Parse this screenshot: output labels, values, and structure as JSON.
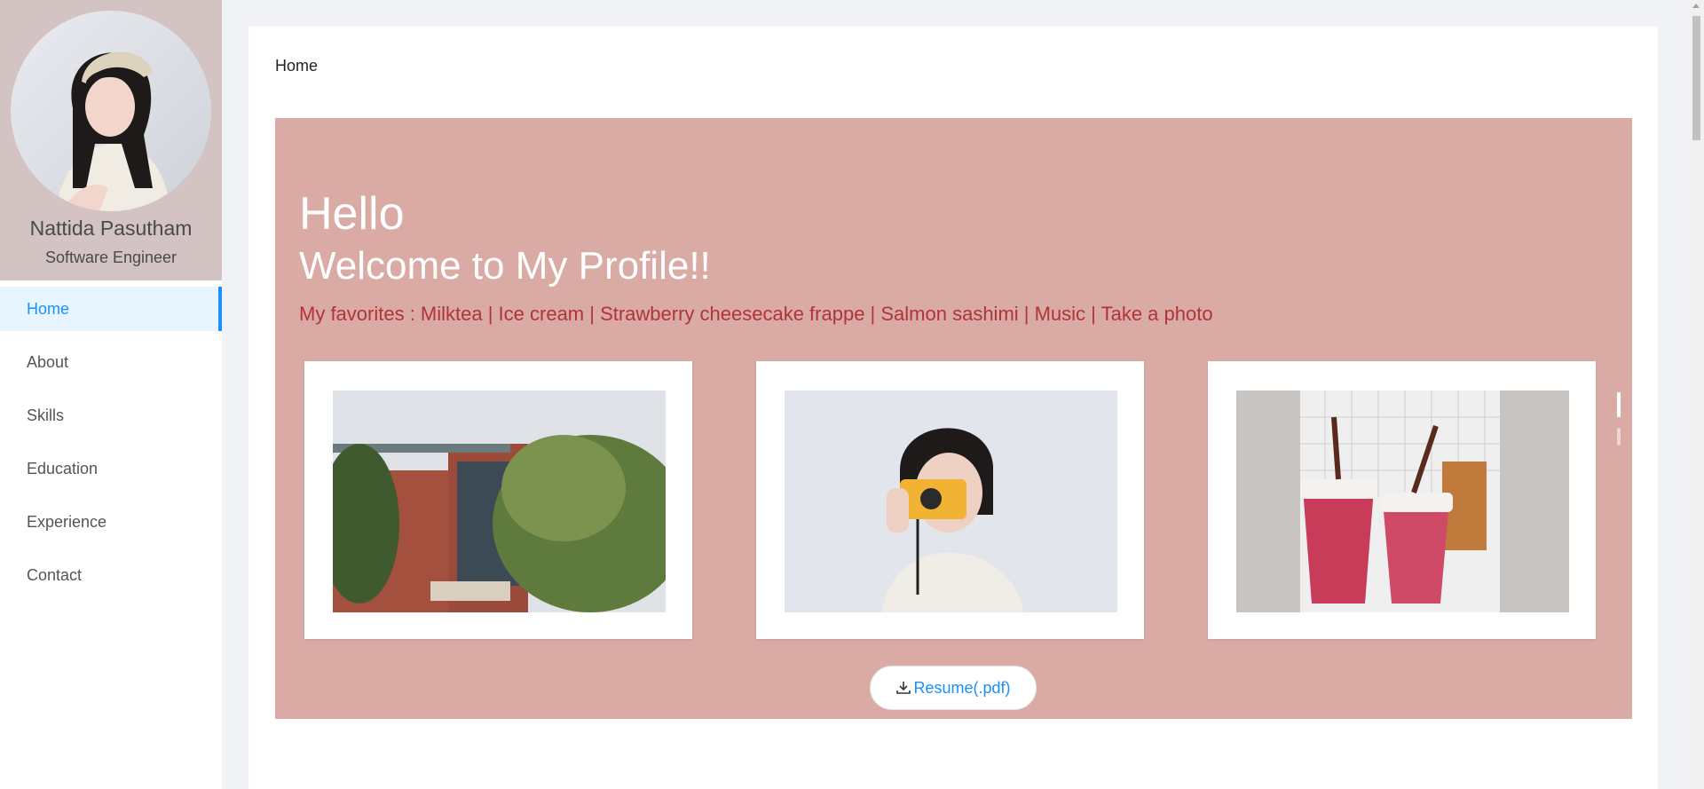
{
  "sidebar": {
    "name": "Nattida Pasutham",
    "role": "Software Engineer",
    "nav": [
      {
        "label": "Home",
        "active": true
      },
      {
        "label": "About"
      },
      {
        "label": "Skills"
      },
      {
        "label": "Education"
      },
      {
        "label": "Experience"
      },
      {
        "label": "Contact"
      }
    ]
  },
  "main": {
    "breadcrumb": "Home",
    "hero": {
      "hello": "Hello",
      "welcome": "Welcome to My Profile!!",
      "favorites": "My favorites : Milktea | Ice cream | Strawberry cheesecake frappe | Salmon sashimi | Music | Take a photo",
      "photos": [
        {
          "subject": "building-with-trees-photo"
        },
        {
          "subject": "girl-with-yellow-camera-photo"
        },
        {
          "subject": "strawberry-drinks-photo"
        }
      ],
      "resume_label": "Resume(.pdf)",
      "carousel_active_index": 0
    }
  },
  "colors": {
    "accent": "#1890ff",
    "hero_bg": "#d9aba4",
    "profile_bg": "#d3c3c2",
    "favorites_text": "#b2333a"
  }
}
